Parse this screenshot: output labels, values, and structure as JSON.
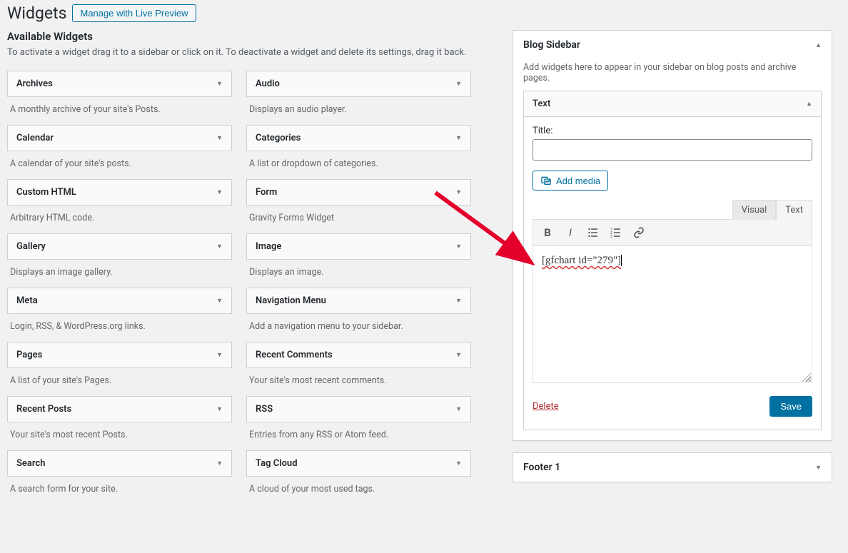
{
  "header": {
    "title": "Widgets",
    "live_preview_label": "Manage with Live Preview"
  },
  "available": {
    "title": "Available Widgets",
    "desc": "To activate a widget drag it to a sidebar or click on it. To deactivate a widget and delete its settings, drag it back."
  },
  "widgets": [
    {
      "name": "Archives",
      "desc": "A monthly archive of your site's Posts."
    },
    {
      "name": "Audio",
      "desc": "Displays an audio player."
    },
    {
      "name": "Calendar",
      "desc": "A calendar of your site's posts."
    },
    {
      "name": "Categories",
      "desc": "A list or dropdown of categories."
    },
    {
      "name": "Custom HTML",
      "desc": "Arbitrary HTML code."
    },
    {
      "name": "Form",
      "desc": "Gravity Forms Widget"
    },
    {
      "name": "Gallery",
      "desc": "Displays an image gallery."
    },
    {
      "name": "Image",
      "desc": "Displays an image."
    },
    {
      "name": "Meta",
      "desc": "Login, RSS, & WordPress.org links."
    },
    {
      "name": "Navigation Menu",
      "desc": "Add a navigation menu to your sidebar."
    },
    {
      "name": "Pages",
      "desc": "A list of your site's Pages."
    },
    {
      "name": "Recent Comments",
      "desc": "Your site's most recent comments."
    },
    {
      "name": "Recent Posts",
      "desc": "Your site's most recent Posts."
    },
    {
      "name": "RSS",
      "desc": "Entries from any RSS or Atom feed."
    },
    {
      "name": "Search",
      "desc": "A search form for your site."
    },
    {
      "name": "Tag Cloud",
      "desc": "A cloud of your most used tags."
    }
  ],
  "sidebar": {
    "title": "Blog Sidebar",
    "desc": "Add widgets here to appear in your sidebar on blog posts and archive pages.",
    "inner_widget_title": "Text",
    "title_field_label": "Title:",
    "title_field_value": "",
    "add_media_label": "Add media",
    "tab_visual": "Visual",
    "tab_text": "Text",
    "editor_content": "[gfchart id=\"279\"]",
    "delete_label": "Delete",
    "save_label": "Save"
  },
  "footer_area": {
    "title": "Footer 1"
  }
}
